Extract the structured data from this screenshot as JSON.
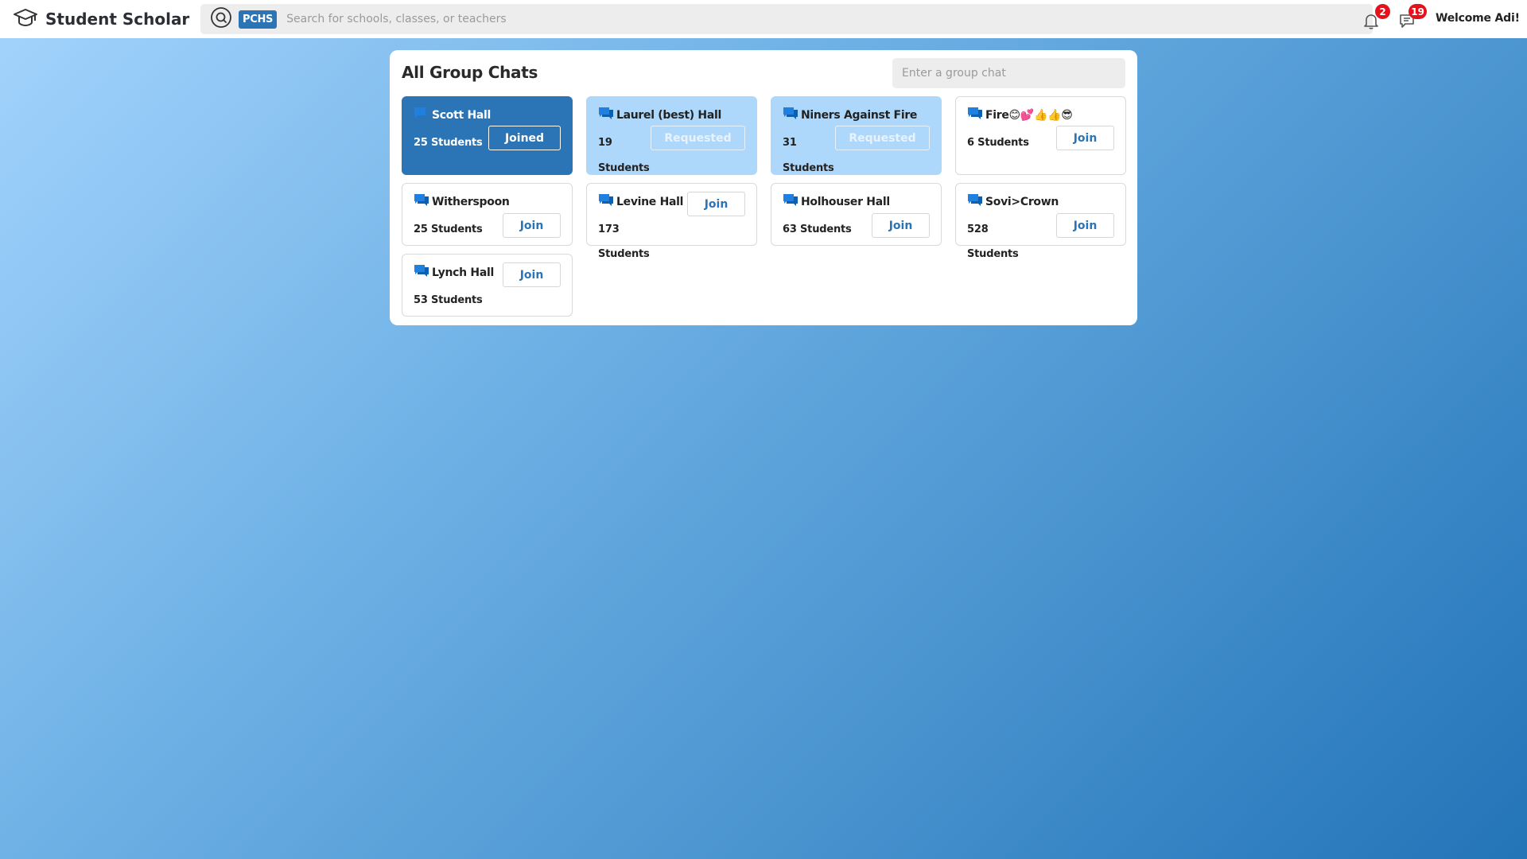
{
  "app": {
    "title": "Student Scholar",
    "brand_icon": "graduation-cap-icon"
  },
  "search": {
    "icon": "search-icon",
    "school_badge": "PCHS",
    "placeholder": "Search for schools, classes, or teachers",
    "value": ""
  },
  "notifications": {
    "bell_icon": "bell-icon",
    "bell_count": "2",
    "chat_icon": "chat-bubble-icon",
    "chat_count": "19"
  },
  "user": {
    "welcome": "Welcome Adi!"
  },
  "panel": {
    "title": "All Group Chats",
    "group_input_placeholder": "Enter a group chat",
    "group_input_value": ""
  },
  "groups": [
    {
      "name": "Scott Hall",
      "count": "25 Students",
      "status": "joined",
      "button": "Joined"
    },
    {
      "name": "Laurel (best) Hall",
      "count": "19 Students",
      "status": "requested",
      "button": "Requested"
    },
    {
      "name": "Niners Against Fire",
      "count": "31 Students",
      "status": "requested",
      "button": "Requested"
    },
    {
      "name": "Fire😊💕👍👍😎",
      "count": "6 Students",
      "status": "open",
      "button": "Join"
    },
    {
      "name": "Witherspoon",
      "count": "25 Students",
      "status": "open",
      "button": "Join"
    },
    {
      "name": "Levine Hall",
      "count": "173 Students",
      "status": "open",
      "button": "Join"
    },
    {
      "name": "Holhouser Hall",
      "count": "63 Students",
      "status": "open",
      "button": "Join"
    },
    {
      "name": "Sovi>Crown",
      "count": "528 Students",
      "status": "open",
      "button": "Join"
    },
    {
      "name": "Lynch Hall",
      "count": "53 Students",
      "status": "open",
      "button": "Join"
    }
  ],
  "colors": {
    "accent": "#2b74b5",
    "requested_bg": "#aed8fb",
    "badge": "#e3121b",
    "bg_gradient_start": "#a4d4fd",
    "bg_gradient_end": "#2374b8"
  }
}
